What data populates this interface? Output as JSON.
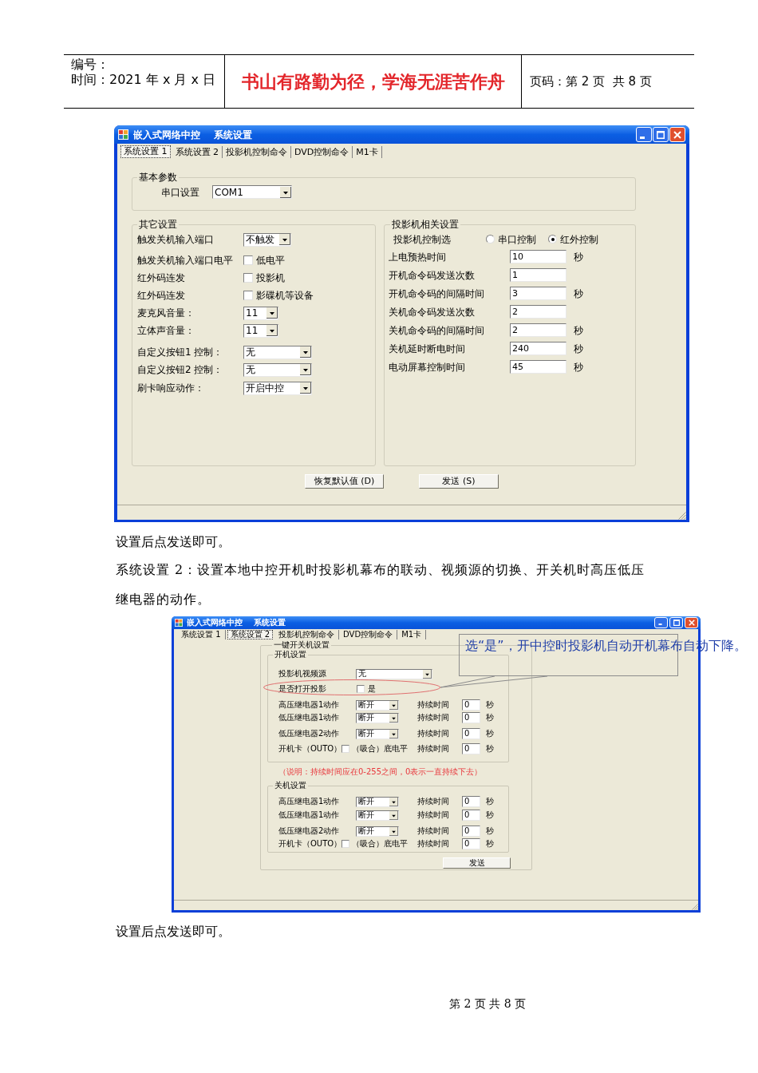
{
  "header": {
    "number_label": "编号：",
    "date_line": "时间：2021 年 x 月 x 日",
    "motto": "书山有路勤为径，学海无涯苦作舟",
    "page_info": "页码：第 2 页  共 8 页"
  },
  "window_1": {
    "title": "嵌入式网络中控    系统设置",
    "tabs": [
      {
        "label": "系统设置 1",
        "selected": true
      },
      {
        "label": "系统设置 2",
        "selected": false
      },
      {
        "label": "投影机控制命令",
        "selected": false
      },
      {
        "label": "DVD控制命令",
        "selected": false
      },
      {
        "label": "M1卡",
        "selected": false
      }
    ],
    "basic_group": {
      "title": "基本参数",
      "label": "串口设置",
      "value": "COM1"
    },
    "other_group": {
      "title": "其它设置",
      "rows": [
        {
          "kind": "dropdown",
          "label": "触发关机输入端口",
          "value": "不触发"
        },
        {
          "kind": "checkbox",
          "label": "触发关机输入端口电平",
          "option": "低电平",
          "checked": false
        },
        {
          "kind": "checkbox",
          "label": "红外码连发",
          "option": "投影机",
          "checked": false
        },
        {
          "kind": "checkbox",
          "label": "红外码连发",
          "option": "影碟机等设备",
          "checked": false
        },
        {
          "kind": "dropdown",
          "label": "麦克风音量：",
          "value": "11"
        },
        {
          "kind": "dropdown",
          "label": "立体声音量：",
          "value": "11"
        },
        {
          "kind": "dropdown",
          "label": "自定义按钮1 控制：",
          "value": "无"
        },
        {
          "kind": "dropdown",
          "label": "自定义按钮2 控制：",
          "value": "无"
        },
        {
          "kind": "dropdown",
          "label": "刷卡响应动作：",
          "value": "开启中控"
        }
      ]
    },
    "projector_group": {
      "title": "投影机相关设置",
      "control_label": "投影机控制选",
      "control_options": [
        {
          "label": "串口控制",
          "selected": false
        },
        {
          "label": "红外控制",
          "selected": true
        }
      ],
      "rows": [
        {
          "label": "上电预热时间",
          "value": "10",
          "unit": "秒"
        },
        {
          "label": "开机命令码发送次数",
          "value": "1"
        },
        {
          "label": "开机命令码的间隔时间",
          "value": "3",
          "unit": "秒"
        },
        {
          "label": "关机命令码发送次数",
          "value": "2"
        },
        {
          "label": "关机命令码的间隔时间",
          "value": "2",
          "unit": "秒"
        },
        {
          "label": "关机延时断电时间",
          "value": "240",
          "unit": "秒"
        },
        {
          "label": "电动屏幕控制时间",
          "value": "45",
          "unit": "秒"
        }
      ]
    },
    "buttons": [
      "恢复默认值 (D)",
      "发送 (S)"
    ]
  },
  "paragraphs": [
    "设置后点发送即可。",
    "系统设置 2：设置本地中控开机时投影机幕布的联动、视频源的切换、开关机时高压低压继电器的动作。"
  ],
  "window_2": {
    "title": "嵌入式网络中控    系统设置",
    "tabs": [
      {
        "label": "系统设置 1",
        "selected": false
      },
      {
        "label": "系统设置 2",
        "selected": true
      },
      {
        "label": "投影机控制命令",
        "selected": false
      },
      {
        "label": "DVD控制命令",
        "selected": false
      },
      {
        "label": "M1卡",
        "selected": false
      }
    ],
    "power_group": {
      "title": "一键开关机设置",
      "on_group": {
        "title": "开机设置",
        "source": {
          "label": "投影机视频源",
          "value": "无"
        },
        "open_projector": {
          "label": "是否打开投影",
          "option": "是",
          "checked": false
        },
        "rows": [
          {
            "kind": "relay",
            "label": "高压继电器1动作",
            "value": "断开",
            "duration_label": "持续时间",
            "duration": "0",
            "unit": "秒"
          },
          {
            "kind": "relay",
            "label": "低压继电器1动作",
            "value": "断开",
            "duration_label": "持续时间",
            "duration": "0",
            "unit": "秒"
          },
          {
            "kind": "relay",
            "label": "低压继电器2动作",
            "value": "断开",
            "duration_label": "持续时间",
            "duration": "0",
            "unit": "秒"
          },
          {
            "kind": "card",
            "label": "开机卡（OUTO）",
            "option": "（吸合）底电平",
            "checked": false,
            "duration_label": "持续时间",
            "duration": "0",
            "unit": "秒"
          }
        ]
      },
      "note": "（说明：持续时间应在0-255之间，0表示一直持续下去）",
      "off_group": {
        "title": "关机设置",
        "rows": [
          {
            "kind": "relay",
            "label": "高压继电器1动作",
            "value": "断开",
            "duration_label": "持续时间",
            "duration": "0",
            "unit": "秒"
          },
          {
            "kind": "relay",
            "label": "低压继电器1动作",
            "value": "断开",
            "duration_label": "持续时间",
            "duration": "0",
            "unit": "秒"
          },
          {
            "kind": "relay",
            "label": "低压继电器2动作",
            "value": "断开",
            "duration_label": "持续时间",
            "duration": "0",
            "unit": "秒"
          },
          {
            "kind": "card",
            "label": "开机卡（OUTO）",
            "option": "（吸合）底电平",
            "checked": false,
            "duration_label": "持续时间",
            "duration": "0",
            "unit": "秒"
          }
        ]
      },
      "button": "发送"
    }
  },
  "annotation": {
    "text": "选“是”，开中控时投影机自动开机幕布自动下降。"
  },
  "closing_text": "设置后点发送即可。",
  "footer": "第 2 页 共 8 页"
}
